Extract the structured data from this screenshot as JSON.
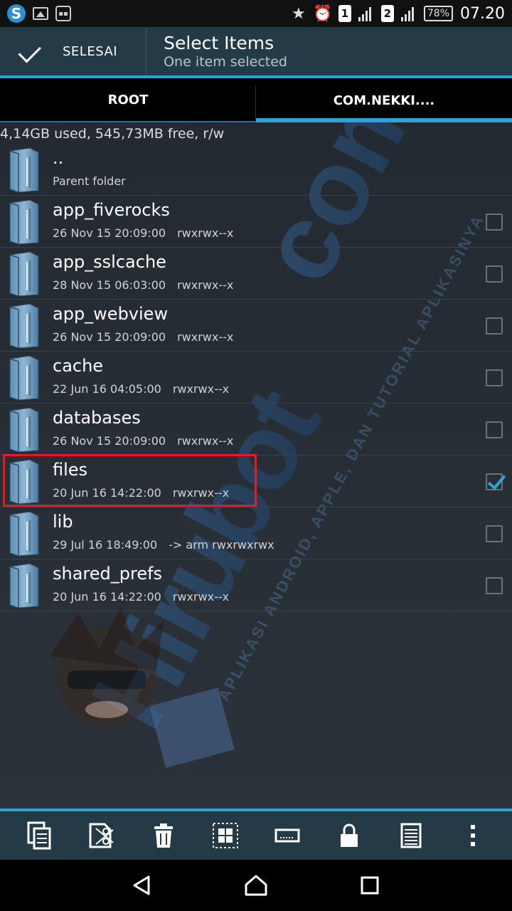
{
  "status_bar": {
    "time": "07.20",
    "battery": "78%",
    "sim1": "1",
    "sim2": "2"
  },
  "action_bar": {
    "done_label": "SELESAI",
    "title": "Select Items",
    "subtitle": "One item selected"
  },
  "tabs": [
    {
      "label": "ROOT",
      "active": false
    },
    {
      "label": "COM.NEKKI....",
      "active": true
    }
  ],
  "storage_info": "4,14GB used, 545,73MB free, r/w",
  "files": [
    {
      "name": "..",
      "date": "Parent folder",
      "perm": "",
      "checkbox": false,
      "checked": false
    },
    {
      "name": "app_fiverocks",
      "date": "26 Nov 15 20:09:00",
      "perm": "rwxrwx--x",
      "checkbox": true,
      "checked": false
    },
    {
      "name": "app_sslcache",
      "date": "28 Nov 15 06:03:00",
      "perm": "rwxrwx--x",
      "checkbox": true,
      "checked": false
    },
    {
      "name": "app_webview",
      "date": "26 Nov 15 20:09:00",
      "perm": "rwxrwx--x",
      "checkbox": true,
      "checked": false
    },
    {
      "name": "cache",
      "date": "22 Jun 16 04:05:00",
      "perm": "rwxrwx--x",
      "checkbox": true,
      "checked": false
    },
    {
      "name": "databases",
      "date": "26 Nov 15 20:09:00",
      "perm": "rwxrwx--x",
      "checkbox": true,
      "checked": false
    },
    {
      "name": "files",
      "date": "20 Jun 16 14:22:00",
      "perm": "rwxrwx--x",
      "checkbox": true,
      "checked": true
    },
    {
      "name": "lib",
      "date": "29 Jul 16 18:49:00",
      "perm": "-> arm  rwxrwxrwx",
      "checkbox": true,
      "checked": false
    },
    {
      "name": "shared_prefs",
      "date": "20 Jun 16 14:22:00",
      "perm": "rwxrwx--x",
      "checkbox": true,
      "checked": false
    }
  ],
  "watermark": {
    "brand": "Hirubot.com",
    "tagline": "APLIKASI ANDROID, APPLE, DAN TUTORIAL APLIKASINYA"
  },
  "toolbar_icons": [
    "copy-icon",
    "cut-icon",
    "delete-icon",
    "select-all-icon",
    "rename-icon",
    "lock-icon",
    "properties-icon",
    "more-icon"
  ],
  "colors": {
    "accent": "#2fa3d9",
    "action_bar": "#243b47",
    "highlight": "#e41b23"
  }
}
